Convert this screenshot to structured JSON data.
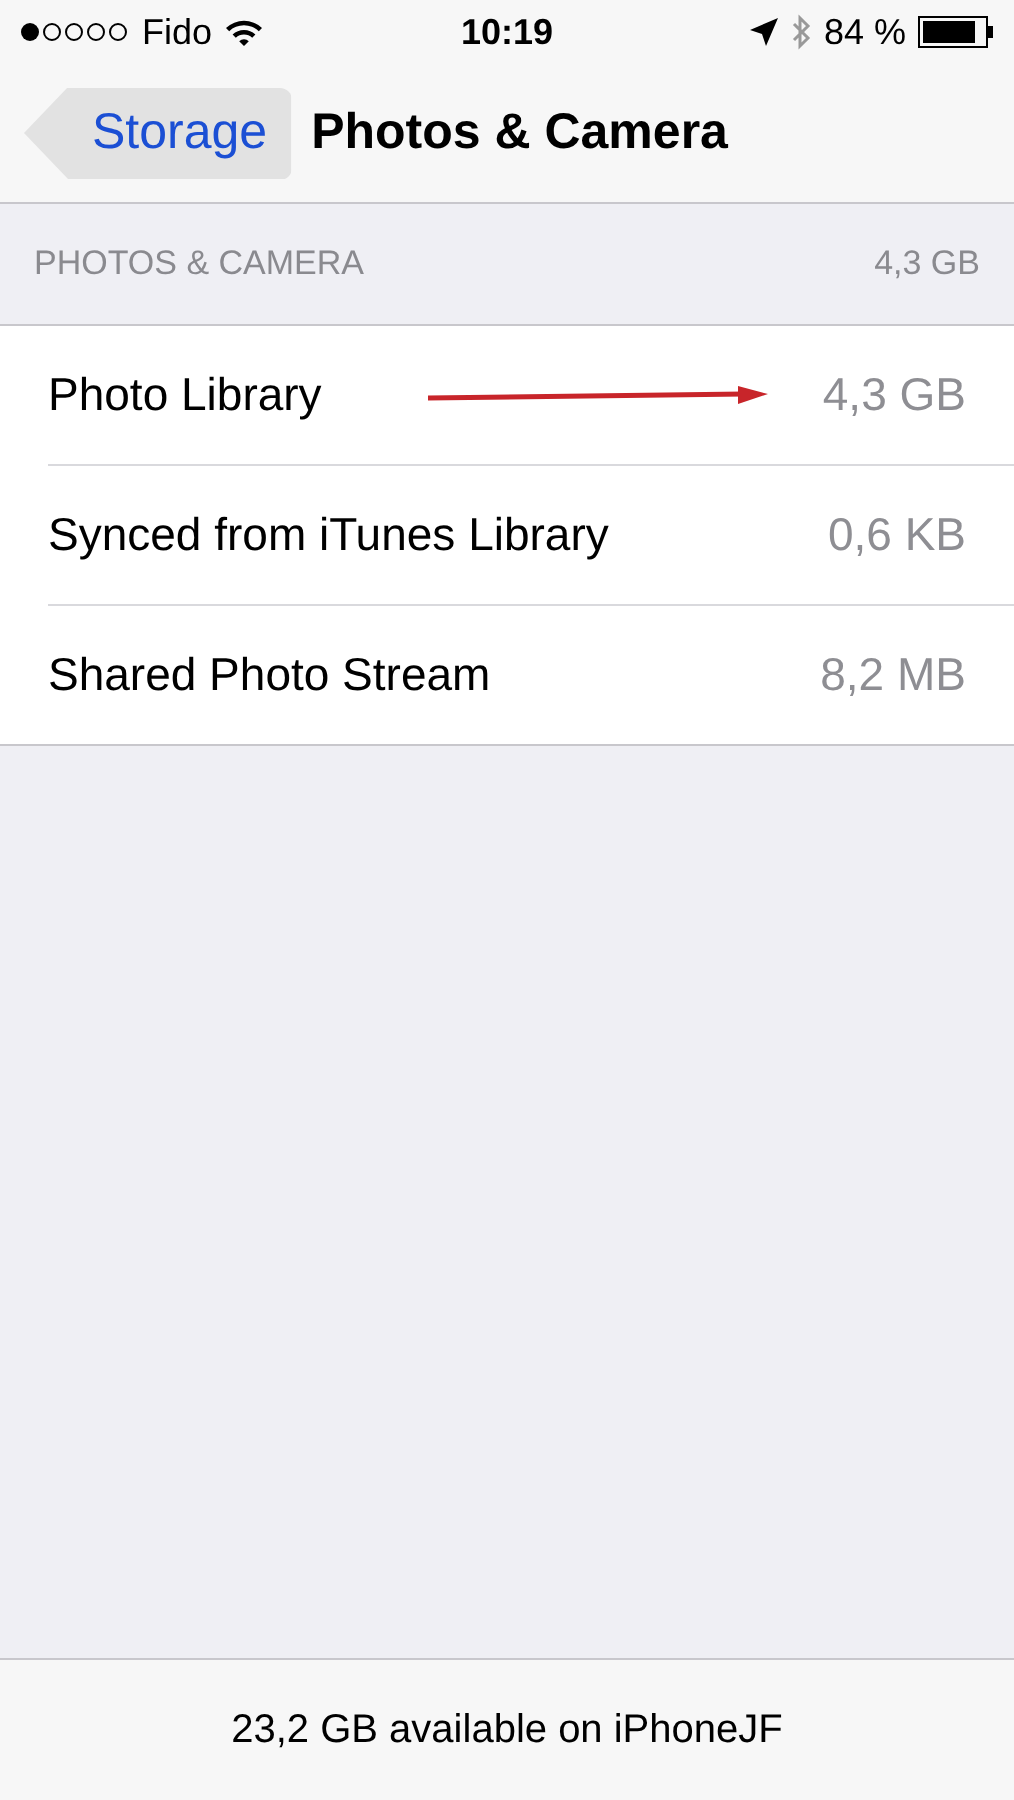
{
  "status_bar": {
    "carrier": "Fido",
    "time": "10:19",
    "battery": "84 %"
  },
  "nav_bar": {
    "back": "Storage",
    "title": "Photos & Camera"
  },
  "section": {
    "title": "PHOTOS & CAMERA",
    "total": "4,3 GB"
  },
  "rows": [
    {
      "label": "Photo Library",
      "size": "4,3 GB",
      "arrow": true
    },
    {
      "label": "Synced from iTunes Library",
      "size": "0,6 KB",
      "arrow": false
    },
    {
      "label": "Shared Photo Stream",
      "size": "8,2 MB",
      "arrow": false
    }
  ],
  "footer": "23,2 GB available on iPhoneJF"
}
